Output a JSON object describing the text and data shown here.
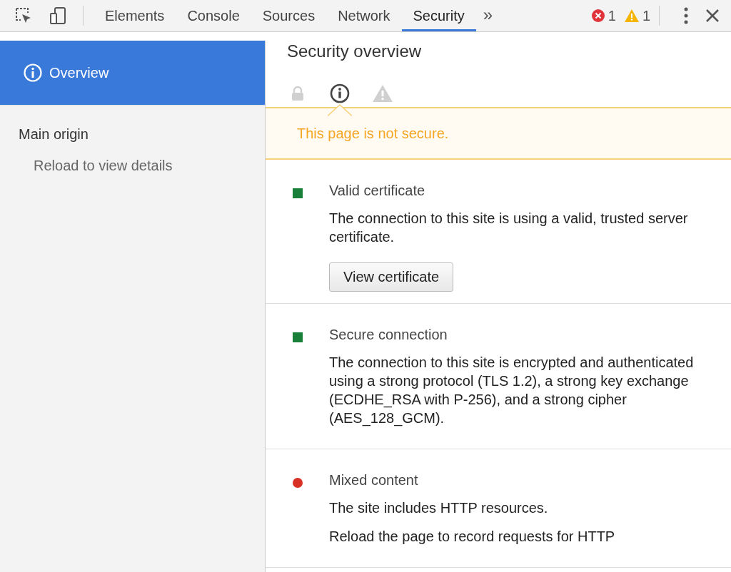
{
  "toolbar": {
    "tools": [
      {
        "kind": "inspect"
      },
      {
        "kind": "device"
      }
    ],
    "tabs": [
      {
        "label": "Elements",
        "selected": false
      },
      {
        "label": "Console",
        "selected": false
      },
      {
        "label": "Sources",
        "selected": false
      },
      {
        "label": "Network",
        "selected": false
      },
      {
        "label": "Security",
        "selected": true
      }
    ],
    "overflow": "»",
    "errors": "1",
    "warnings": "1"
  },
  "sidebar": {
    "items": [
      {
        "label": "Overview",
        "selected": true
      }
    ],
    "heading": "Main origin",
    "note": "Reload to view details"
  },
  "overview": {
    "title": "Security overview",
    "summary_icons": [
      {
        "kind": "lock",
        "selected": false
      },
      {
        "kind": "info",
        "selected": true
      },
      {
        "kind": "warning",
        "selected": false
      }
    ],
    "banner": "This page is not secure.",
    "sections": [
      {
        "title": "Valid certificate",
        "color": "#188038",
        "kind": "square",
        "paragraphs": [
          "The connection to this site is using a valid, trusted server certificate."
        ],
        "button": "View certificate"
      },
      {
        "title": "Secure connection",
        "color": "#188038",
        "kind": "square",
        "paragraphs": [
          "The connection to this site is encrypted and authenticated using a strong protocol (TLS 1.2), a strong key exchange (ECDHE_RSA with P-256), and a strong cipher (AES_128_GCM)."
        ]
      },
      {
        "title": "Mixed content",
        "color": "#d93025",
        "kind": "circle",
        "paragraphs": [
          "The site includes HTTP resources.",
          "Reload the page to record requests for HTTP"
        ]
      }
    ]
  }
}
